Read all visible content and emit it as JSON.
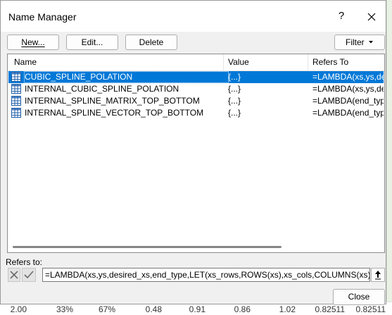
{
  "window": {
    "title": "Name Manager",
    "help_label": "?"
  },
  "toolbar": {
    "new_label": "New...",
    "edit_label": "Edit...",
    "delete_label": "Delete",
    "filter_label": "Filter"
  },
  "list": {
    "columns": [
      "Name",
      "Value",
      "Refers To"
    ],
    "rows": [
      {
        "name": "CUBIC_SPLINE_POLATION",
        "value": "{...}",
        "refers": "=LAMBDA(xs,ys,des...",
        "selected": true
      },
      {
        "name": "INTERNAL_CUBIC_SPLINE_POLATION",
        "value": "{...}",
        "refers": "=LAMBDA(xs,ys,des...",
        "selected": false
      },
      {
        "name": "INTERNAL_SPLINE_MATRIX_TOP_BOTTOM",
        "value": "{...}",
        "refers": "=LAMBDA(end_typ...",
        "selected": false
      },
      {
        "name": "INTERNAL_SPLINE_VECTOR_TOP_BOTTOM",
        "value": "{...}",
        "refers": "=LAMBDA(end_typ...",
        "selected": false
      }
    ]
  },
  "refers_to": {
    "label": "Refers to:",
    "formula": "=LAMBDA(xs,ys,desired_xs,end_type,LET(xs_rows,ROWS(xs),xs_cols,COLUMNS(xs),ys_rows,ROWS(ys),ys_cols,COLUMNS(ys),"
  },
  "footer": {
    "close_label": "Close"
  },
  "background_sheet": {
    "cells": [
      "2.00",
      "33%",
      "67%",
      "0.48",
      "0.91",
      "0.86",
      "1.02",
      "0.82511",
      "0.82511"
    ]
  },
  "colors": {
    "selection": "#0078d7",
    "dialog_bg": "#f0f0f0"
  }
}
